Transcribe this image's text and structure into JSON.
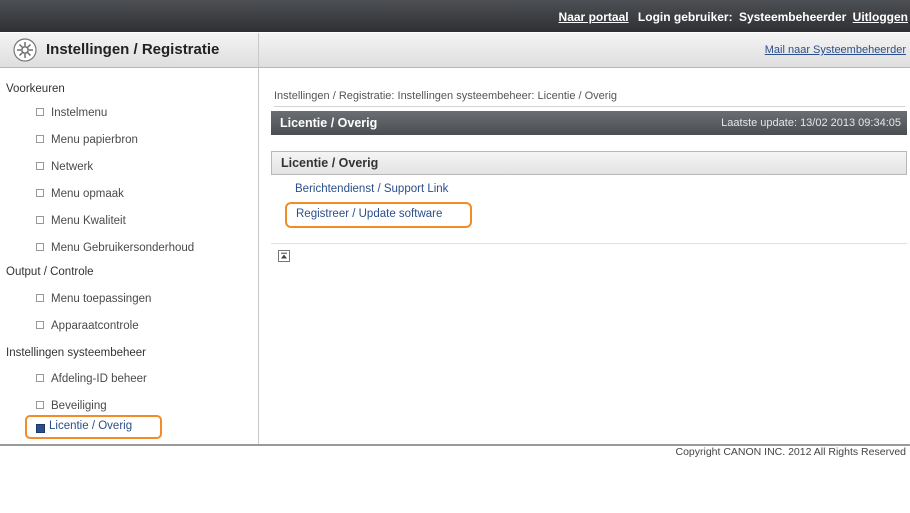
{
  "topbar": {
    "portal_link": "Naar portaal",
    "login_label": "Login gebruiker:",
    "login_user": "Systeembeheerder",
    "logout": "Uitloggen"
  },
  "header": {
    "icon": "gear-icon",
    "title": "Instellingen / Registratie",
    "mail_link": "Mail naar Systeembeheerder"
  },
  "sidebar": {
    "sections": [
      {
        "label": "Voorkeuren",
        "items": [
          "Instelmenu",
          "Menu papierbron",
          "Netwerk",
          "Menu opmaak",
          "Menu Kwaliteit",
          "Menu Gebruikersonderhoud"
        ]
      },
      {
        "label": "Output / Controle",
        "items": [
          "Menu toepassingen",
          "Apparaatcontrole"
        ]
      },
      {
        "label": "Instellingen systeembeheer",
        "items": [
          "Afdeling-ID beheer",
          "Beveiliging"
        ]
      }
    ],
    "active_item": "Licentie / Overig"
  },
  "main": {
    "breadcrumb": "Instellingen / Registratie: Instellingen systeembeheer: Licentie / Overig",
    "page_title": "Licentie / Overig",
    "last_update": "Laatste update: 13/02 2013 09:34:05",
    "section_title": "Licentie / Overig",
    "links": [
      "Berichtendienst / Support Link",
      "Registreer / Update software"
    ]
  },
  "footer": {
    "copyright": "Copyright CANON INC. 2012 All Rights Reserved"
  },
  "colors": {
    "highlight": "#f28c28",
    "link": "#2b4f8a",
    "topbar": "#3a3c3f"
  }
}
